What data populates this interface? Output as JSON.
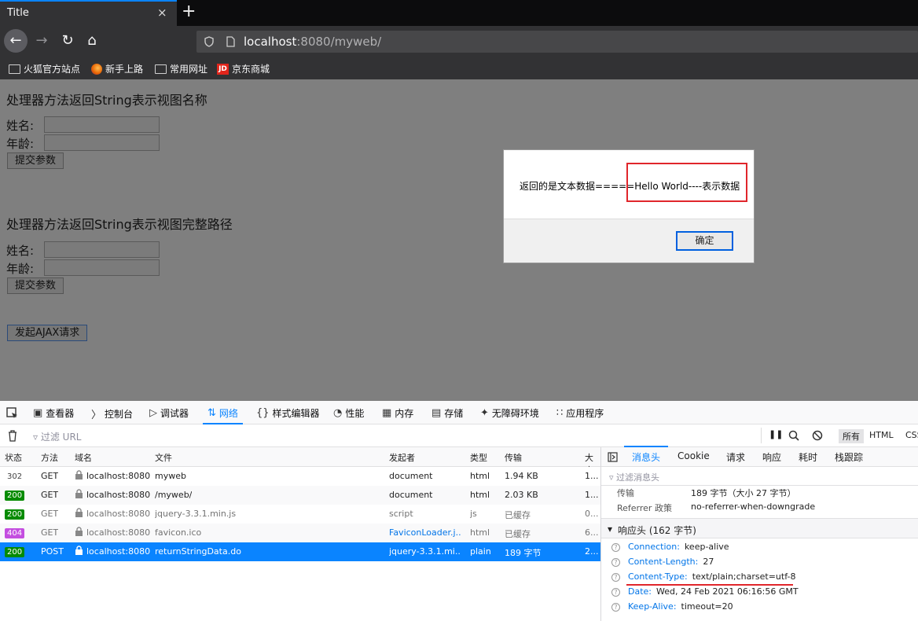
{
  "browser": {
    "tab_title": "Title",
    "close_glyph": "×",
    "new_tab_glyph": "+",
    "url_host": "localhost",
    "url_rest": ":8080/myweb/",
    "bookmarks": [
      "火狐官方站点",
      "新手上路",
      "常用网址",
      "京东商城"
    ]
  },
  "page": {
    "section1_title": "处理器方法返回String表示视图名称",
    "section2_title": "处理器方法返回String表示视图完整路径",
    "name_label": "姓名:",
    "age_label": "年龄:",
    "submit_label": "提交参数",
    "ajax_label": "发起AJAX请求"
  },
  "dialog": {
    "message": "返回的是文本数据=====Hello World----表示数据",
    "ok_label": "确定"
  },
  "devtools": {
    "tools": [
      "查看器",
      "控制台",
      "调试器",
      "网络",
      "样式编辑器",
      "性能",
      "内存",
      "存储",
      "无障碍环境",
      "应用程序"
    ],
    "filter_placeholder": "过滤 URL",
    "type_filters": [
      "所有",
      "HTML",
      "CSS"
    ],
    "columns": [
      "状态",
      "方法",
      "域名",
      "文件",
      "发起者",
      "类型",
      "传输",
      "大小"
    ],
    "requests": [
      {
        "status": "302",
        "method": "GET",
        "domain": "localhost:8080",
        "file": "myweb",
        "initiator": "document",
        "type": "html",
        "transfer": "1.94 KB",
        "size": "1..."
      },
      {
        "status": "200",
        "method": "GET",
        "domain": "localhost:8080",
        "file": "/myweb/",
        "initiator": "document",
        "type": "html",
        "transfer": "2.03 KB",
        "size": "1..."
      },
      {
        "status": "200",
        "method": "GET",
        "domain": "localhost:8080",
        "file": "jquery-3.3.1.min.js",
        "initiator": "script",
        "type": "js",
        "transfer": "已缓存",
        "size": "0..."
      },
      {
        "status": "404",
        "method": "GET",
        "domain": "localhost:8080",
        "file": "favicon.ico",
        "initiator": "FaviconLoader.j...",
        "type": "html",
        "transfer": "已缓存",
        "size": "6..."
      },
      {
        "status": "200",
        "method": "POST",
        "domain": "localhost:8080",
        "file": "returnStringData.do",
        "initiator": "jquery-3.3.1.mi...",
        "type": "plain",
        "transfer": "189 字节",
        "size": "2..."
      }
    ],
    "detail_tabs": [
      "消息头",
      "Cookie",
      "请求",
      "响应",
      "耗时",
      "栈跟踪"
    ],
    "detail_filter": "过滤消息头",
    "transfer_label": "传输",
    "transfer_value": "189 字节（大小 27 字节）",
    "referrer_label": "Referrer 政策",
    "referrer_value": "no-referrer-when-downgrade",
    "response_headers_title": "响应头 (162 字节)",
    "headers": [
      {
        "key": "Connection:",
        "value": "keep-alive"
      },
      {
        "key": "Content-Length:",
        "value": "27"
      },
      {
        "key": "Content-Type:",
        "value": "text/plain;charset=utf-8"
      },
      {
        "key": "Date:",
        "value": "Wed, 24 Feb 2021 06:16:56 GMT"
      },
      {
        "key": "Keep-Alive:",
        "value": "timeout=20"
      }
    ]
  },
  "colors": {
    "accent": "#0a84ff",
    "highlight": "#e0262b",
    "status_ok": "#058b00",
    "status_404": "#c44ee0"
  }
}
